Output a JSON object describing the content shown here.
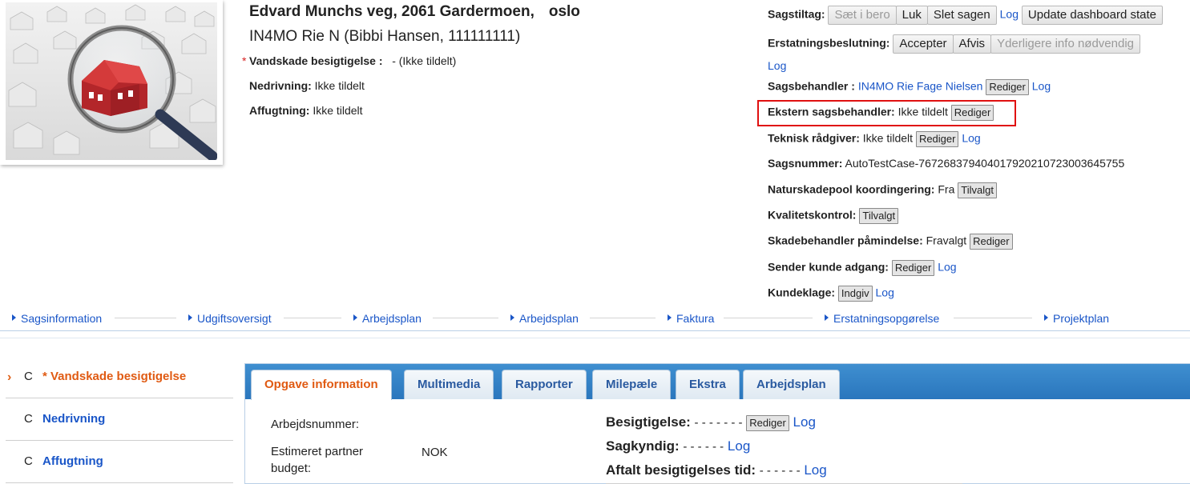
{
  "case": {
    "address": "Edvard Munchs veg, 2061 Gardermoen,",
    "city": "oslo",
    "contact": "IN4MO Rie N (Bibbi Hansen, 111111111)",
    "lines": [
      {
        "label": "Vandskade besigtigelse :",
        "value": "- (Ikke tildelt)",
        "required": true
      },
      {
        "label": "Nedrivning:",
        "value": "Ikke tildelt",
        "required": false
      },
      {
        "label": "Affugtning:",
        "value": "Ikke tildelt",
        "required": false
      }
    ]
  },
  "right": {
    "sagstiltag": {
      "label": "Sagstiltag:",
      "buttons": [
        "Sæt i bero",
        "Luk",
        "Slet sagen"
      ],
      "log": "Log",
      "update": "Update dashboard state"
    },
    "erstatning": {
      "label": "Erstatningsbeslutning:",
      "buttons": [
        "Accepter",
        "Afvis",
        "Yderligere info nødvendig"
      ],
      "log": "Log"
    },
    "sagsbehandler": {
      "label": "Sagsbehandler :",
      "value": "IN4MO Rie Fage Nielsen",
      "button": "Rediger",
      "log": "Log"
    },
    "ekstern": {
      "label": "Ekstern sagsbehandler:",
      "value": "Ikke tildelt",
      "button": "Rediger"
    },
    "teknisk": {
      "label": "Teknisk rådgiver:",
      "value": "Ikke tildelt",
      "button": "Rediger",
      "log": "Log"
    },
    "sagsnummer": {
      "label": "Sagsnummer:",
      "value": "AutoTestCase-7672683794040179202107230036457​55"
    },
    "naturskade": {
      "label": "Naturskadepool koordingering:",
      "value": "Fra",
      "button": "Tilvalgt"
    },
    "kvalitet": {
      "label": "Kvalitetskontrol:",
      "button": "Tilvalgt"
    },
    "skadebehandler": {
      "label": "Skadebehandler påmindelse:",
      "value": "Fravalgt",
      "button": "Rediger"
    },
    "sender": {
      "label": "Sender kunde adgang:",
      "button": "Rediger",
      "log": "Log"
    },
    "kundeklage": {
      "label": "Kundeklage:",
      "button": "Indgiv",
      "log": "Log"
    }
  },
  "nav": [
    "Sagsinformation",
    "Udgiftsoversigt",
    "Arbejdsplan",
    "Arbejdsplan",
    "Faktura",
    "Erstatningsopgørelse",
    "Projektplan"
  ],
  "tasks": [
    {
      "c": "C",
      "name": "* Vandskade besigtigelse",
      "active": true
    },
    {
      "c": "C",
      "name": "Nedrivning",
      "active": false
    },
    {
      "c": "C",
      "name": "Affugtning",
      "active": false
    }
  ],
  "tabs": [
    "Opgave information",
    "Multimedia",
    "Rapporter",
    "Milepæle",
    "Ekstra",
    "Arbejdsplan"
  ],
  "info": {
    "arbejdsnummer": "Arbejdsnummer:",
    "budget_label_1": "Estimeret partner",
    "budget_label_2": "budget:",
    "budget_value": "NOK",
    "besigtigelse": {
      "label": "Besigtigelse:",
      "value": "- - - - - -   -",
      "button": "Rediger",
      "log": "Log"
    },
    "sagkyndig": {
      "label": "Sagkyndig:",
      "value": "- - - - - -",
      "log": "Log"
    },
    "aftalt": {
      "label": "Aftalt besigtigelses tid:",
      "value": "- - - - - -",
      "log": "Log"
    }
  },
  "colors": {
    "link": "#1a56c8",
    "active_orange": "#e05a12",
    "tabbar_blue": "#2a76bd",
    "highlight_red": "#e01010"
  }
}
